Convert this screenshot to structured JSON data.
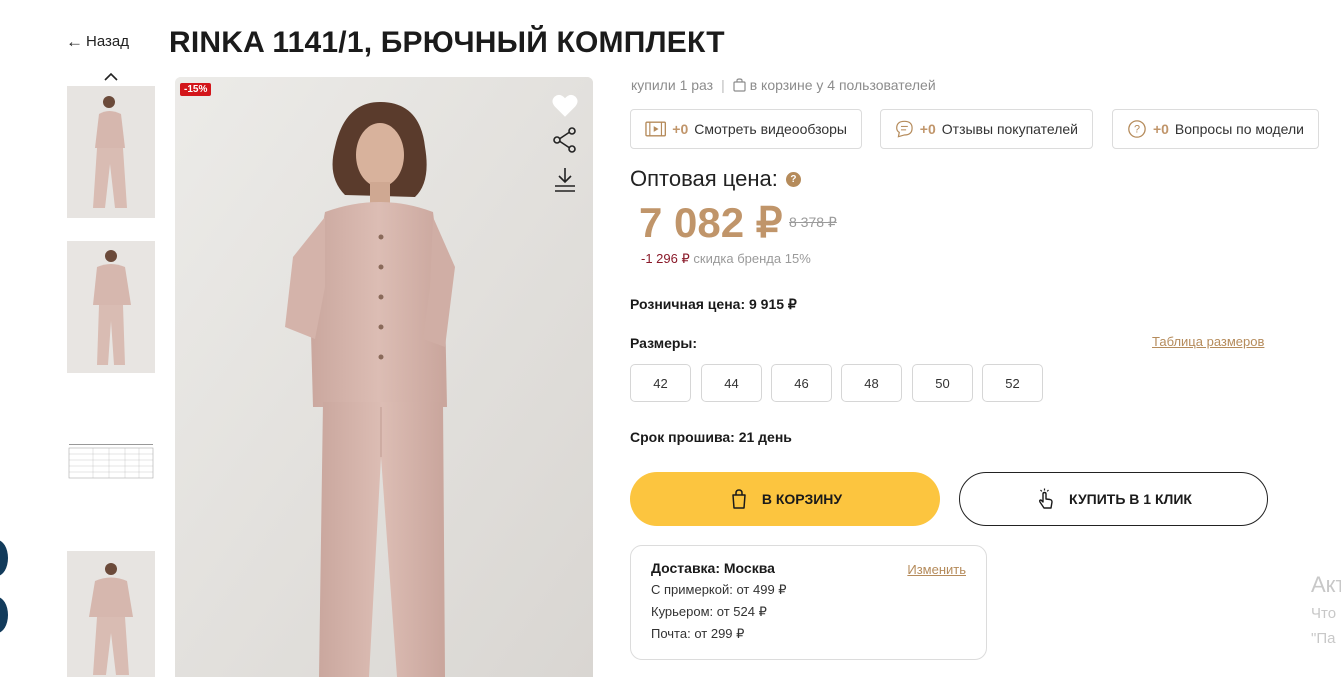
{
  "nav": {
    "back_label": "Назад"
  },
  "product": {
    "title": "RINKA 1141/1, БРЮЧНЫЙ КОМПЛЕКТ",
    "discount_badge": "-15%"
  },
  "stats": {
    "bought": "купили 1 раз",
    "separator": "|",
    "in_cart": "в корзине у 4 пользователей"
  },
  "pills": [
    {
      "count": "+0",
      "label": "Смотреть видеообзоры",
      "icon": "video-icon"
    },
    {
      "count": "+0",
      "label": "Отзывы покупателей",
      "icon": "chat-icon"
    },
    {
      "count": "+0",
      "label": "Вопросы по модели",
      "icon": "question-icon"
    }
  ],
  "price": {
    "wholesale_label": "Оптовая цена:",
    "help_glyph": "?",
    "current": "7 082 ₽",
    "old": "8 378 ₽",
    "discount_amount": "-1 296 ₽",
    "discount_text": "скидка бренда 15%",
    "retail": "Розничная цена: 9 915 ₽"
  },
  "sizes": {
    "label": "Размеры:",
    "table_link": "Таблица размеров",
    "options": [
      "42",
      "44",
      "46",
      "48",
      "50",
      "52"
    ]
  },
  "production": {
    "term": "Срок прошива: 21 день"
  },
  "actions": {
    "cart": "В КОРЗИНУ",
    "one_click": "КУПИТЬ В 1 КЛИК"
  },
  "delivery": {
    "title": "Доставка: Москва",
    "change": "Изменить",
    "rows": [
      "С примеркой: от 499 ₽",
      "Курьером: от 524 ₽",
      "Почта: от 299 ₽"
    ]
  },
  "side_text": {
    "line1": "Акт",
    "line2": "Что",
    "line3": "\"Па"
  },
  "colors": {
    "accent": "#c0956a",
    "cart_button": "#fcc53f",
    "badge": "#d3161b",
    "link": "#b58b5b"
  }
}
